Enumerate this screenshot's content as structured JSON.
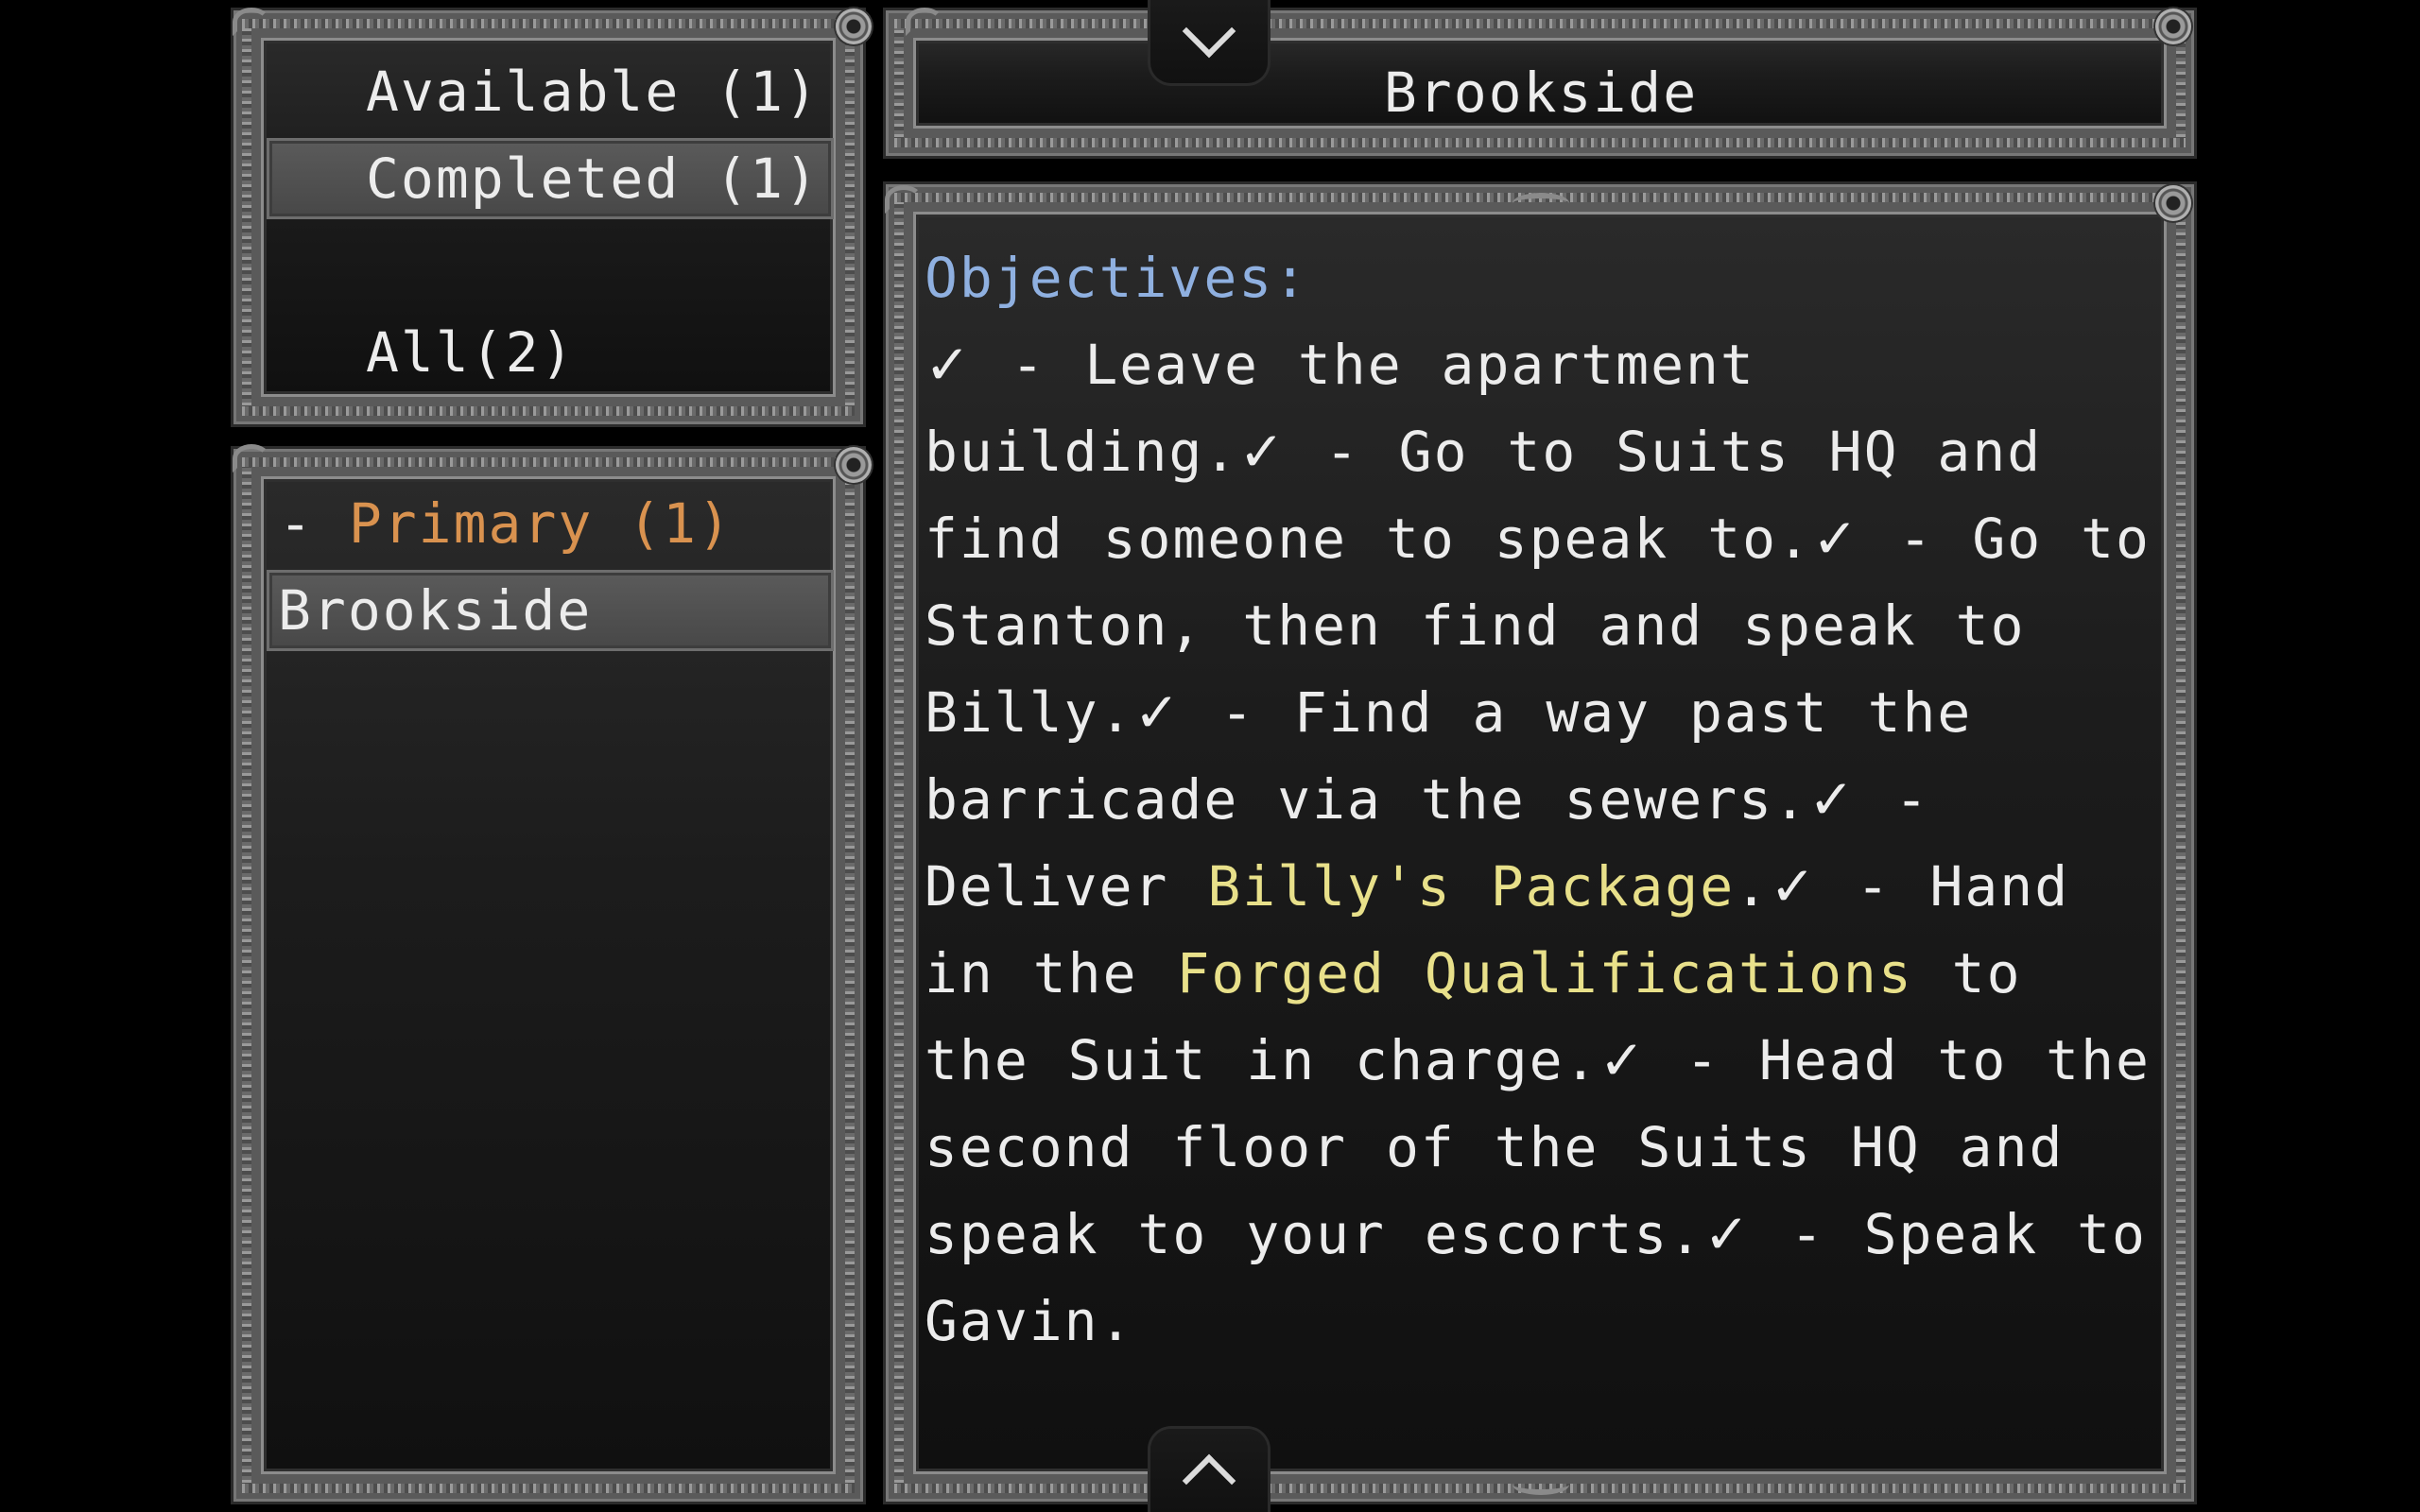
{
  "filters": {
    "available": "Available (1)",
    "completed": "Completed (1)",
    "all": "All(2)"
  },
  "quest_list": {
    "category_prefix": "- ",
    "category_label": "Primary (1)",
    "items": [
      "Brookside"
    ]
  },
  "quest_detail": {
    "title": "Brookside",
    "objectives_heading": "Objectives:",
    "check_glyph": "✓",
    "text": {
      "o1": " - Leave the apartment building.",
      "o2": " - Go to Suits HQ and find someone to speak to.",
      "o3": " - Go to Stanton, then find and speak to Billy.",
      "o4": " - Find a way past the barricade via the sewers.",
      "o5_pre": " - Deliver ",
      "o5_item": "Billy's Package",
      "o5_post": ".",
      "o6_pre": " - Hand in the ",
      "o6_item": "Forged Qualifications",
      "o6_post": " to the Suit in charge.",
      "o7": " - Head to the second floor of the Suits HQ and speak to your escorts.",
      "o8": " - Speak to Gavin."
    }
  },
  "colors": {
    "objectives_heading": "#8fb0e0",
    "category": "#d9924f",
    "item_highlight": "#e8e08a",
    "text": "#ececec"
  }
}
